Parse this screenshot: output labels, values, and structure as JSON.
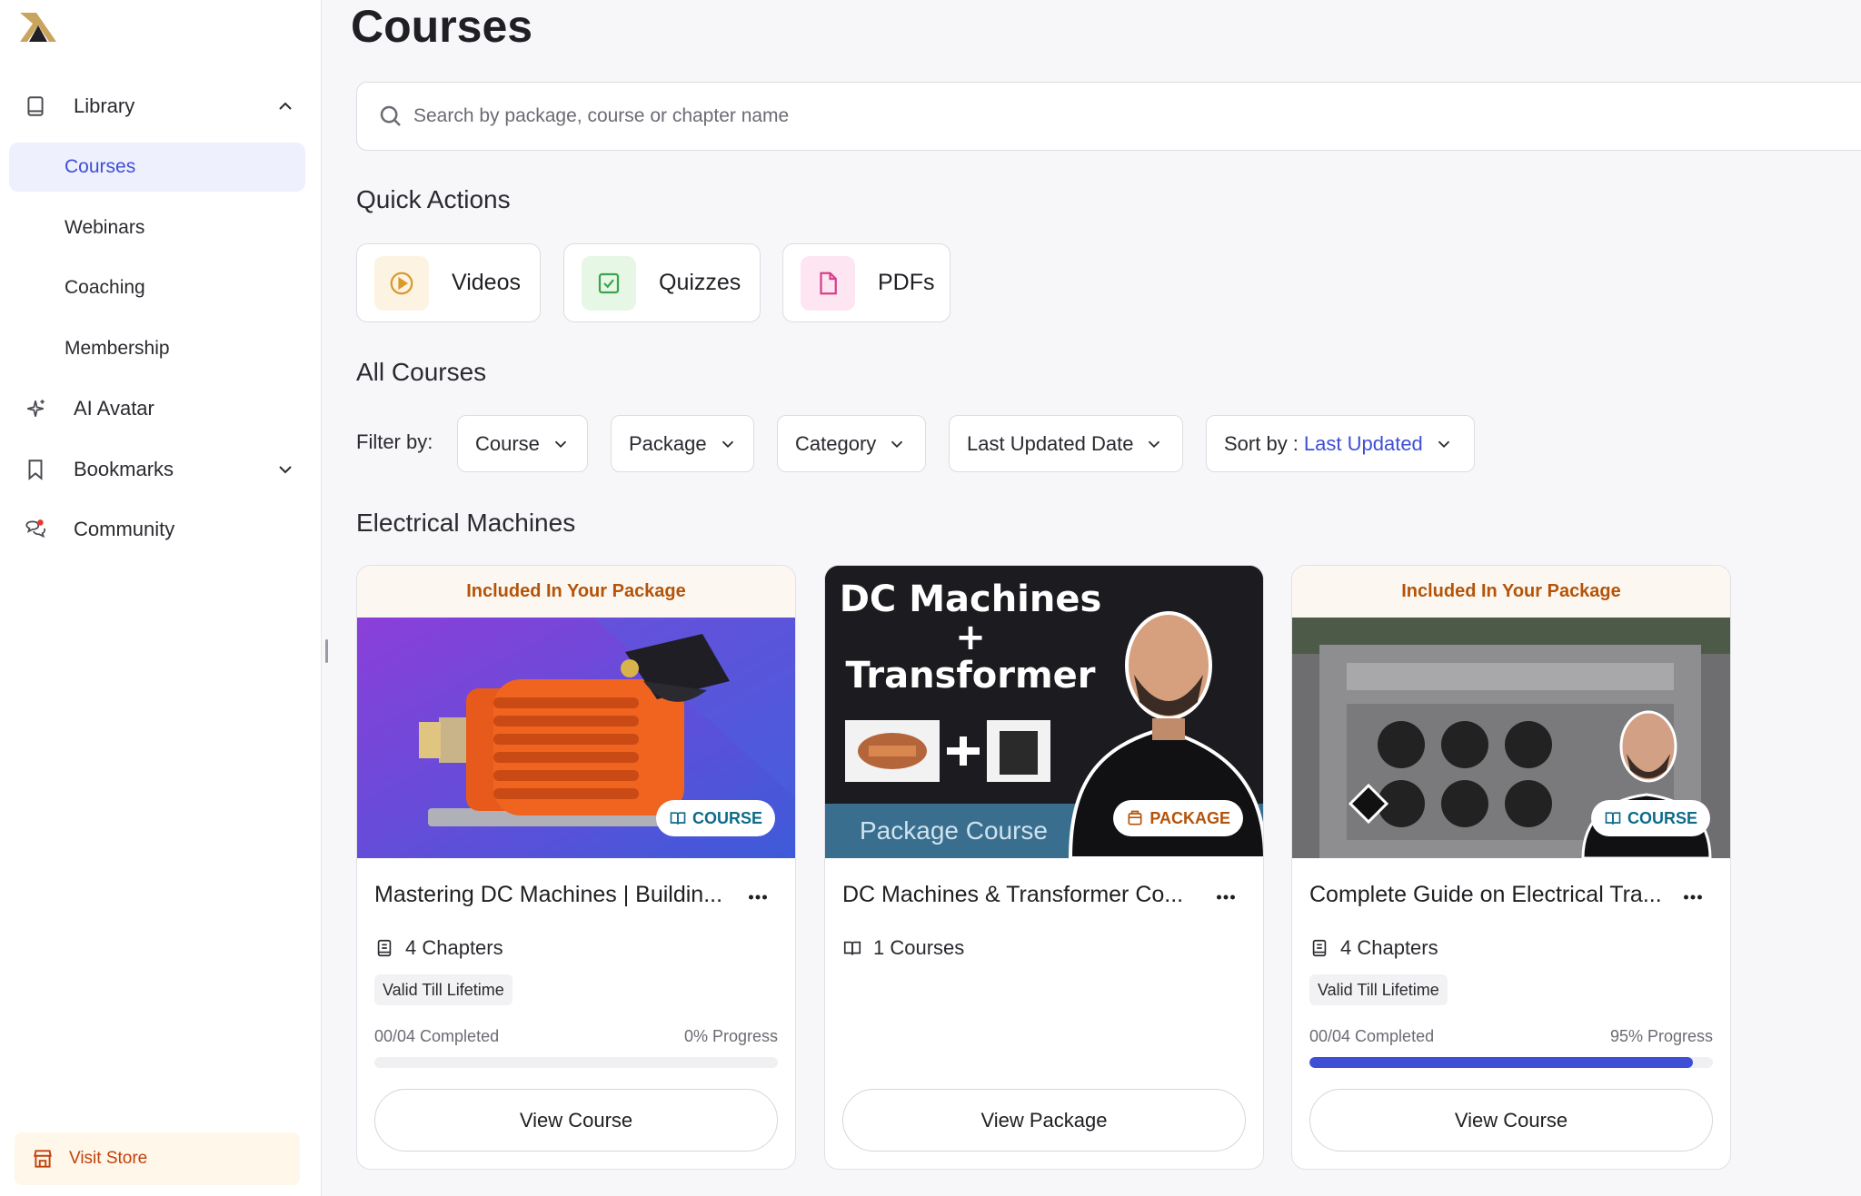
{
  "sidebar": {
    "library": {
      "label": "Library"
    },
    "sub_items": [
      {
        "label": "Courses",
        "active": true
      },
      {
        "label": "Webinars"
      },
      {
        "label": "Coaching"
      },
      {
        "label": "Membership"
      }
    ],
    "ai_avatar": {
      "label": "AI Avatar"
    },
    "bookmarks": {
      "label": "Bookmarks"
    },
    "community": {
      "label": "Community"
    },
    "visit_store": {
      "label": "Visit Store"
    }
  },
  "page": {
    "title": "Courses"
  },
  "search": {
    "placeholder": "Search by package, course or chapter name"
  },
  "quick_actions": {
    "title": "Quick Actions",
    "items": [
      {
        "label": "Videos",
        "icon": "play-circle-icon",
        "bg": "#fdf3e3",
        "color": "#d99a2b"
      },
      {
        "label": "Quizzes",
        "icon": "checkbox-icon",
        "bg": "#e6f7e6",
        "color": "#3fa34d"
      },
      {
        "label": "PDFs",
        "icon": "document-icon",
        "bg": "#fde6f2",
        "color": "#d6408a"
      }
    ]
  },
  "all_courses": {
    "title": "All Courses",
    "filter_label": "Filter by:",
    "filters": [
      "Course",
      "Package",
      "Category",
      "Last Updated Date"
    ],
    "sort_label": "Sort by :",
    "sort_value": "Last Updated"
  },
  "category": {
    "title": "Electrical Machines"
  },
  "cards": [
    {
      "ribbon": "Included In Your Package",
      "type": "COURSE",
      "title": "Mastering DC Machines | Buildin...",
      "meta": "4 Chapters",
      "valid": "Valid Till Lifetime",
      "completed": "00/04 Completed",
      "progress": "0% Progress",
      "progress_value": 0,
      "button": "View Course"
    },
    {
      "type": "PACKAGE",
      "thumb_title_line1": "DC Machines",
      "thumb_title_line2": "+",
      "thumb_title_line3": "Transformer",
      "thumb_footer": "Package Course",
      "title": "DC Machines & Transformer Co...",
      "meta": "1 Courses",
      "button": "View Package"
    },
    {
      "ribbon": "Included In Your Package",
      "type": "COURSE",
      "title": "Complete Guide on Electrical Tra...",
      "meta": "4 Chapters",
      "valid": "Valid Till Lifetime",
      "completed": "00/04 Completed",
      "progress": "95% Progress",
      "progress_value": 0.95,
      "button": "View Course"
    }
  ],
  "colors": {
    "accent": "#3e4fd6",
    "ribbon_text": "#b45309",
    "store_text": "#c2410c"
  }
}
